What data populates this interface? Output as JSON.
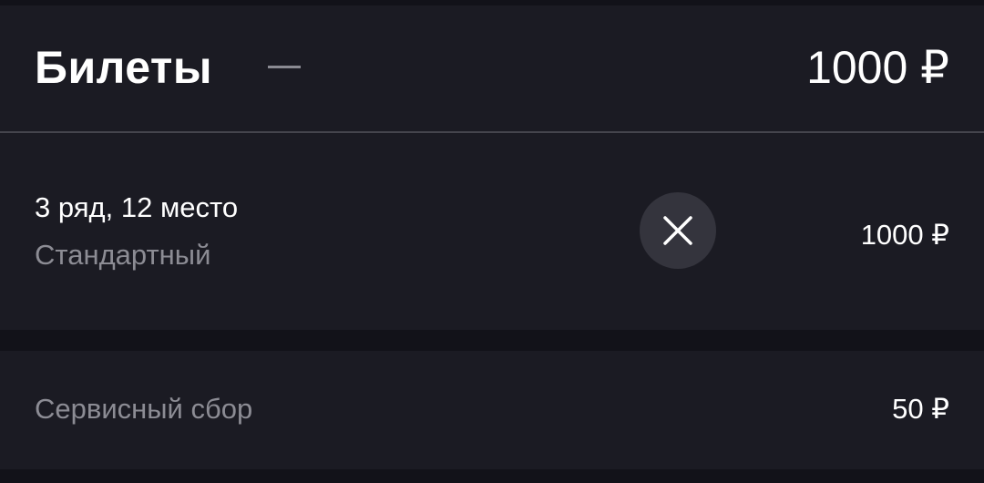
{
  "tickets": {
    "title": "Билеты",
    "total": "1000 ₽",
    "items": [
      {
        "seat": "3 ряд, 12 место",
        "category": "Стандартный",
        "price": "1000 ₽",
        "remove_icon": "close-icon"
      }
    ]
  },
  "service_fee": {
    "label": "Сервисный сбор",
    "price": "50 ₽"
  },
  "colors": {
    "background": "#121219",
    "card": "#1b1b23",
    "text_primary": "#ffffff",
    "text_secondary": "#8c8c94",
    "button_bg": "#34343d",
    "divider": "#45454d"
  }
}
